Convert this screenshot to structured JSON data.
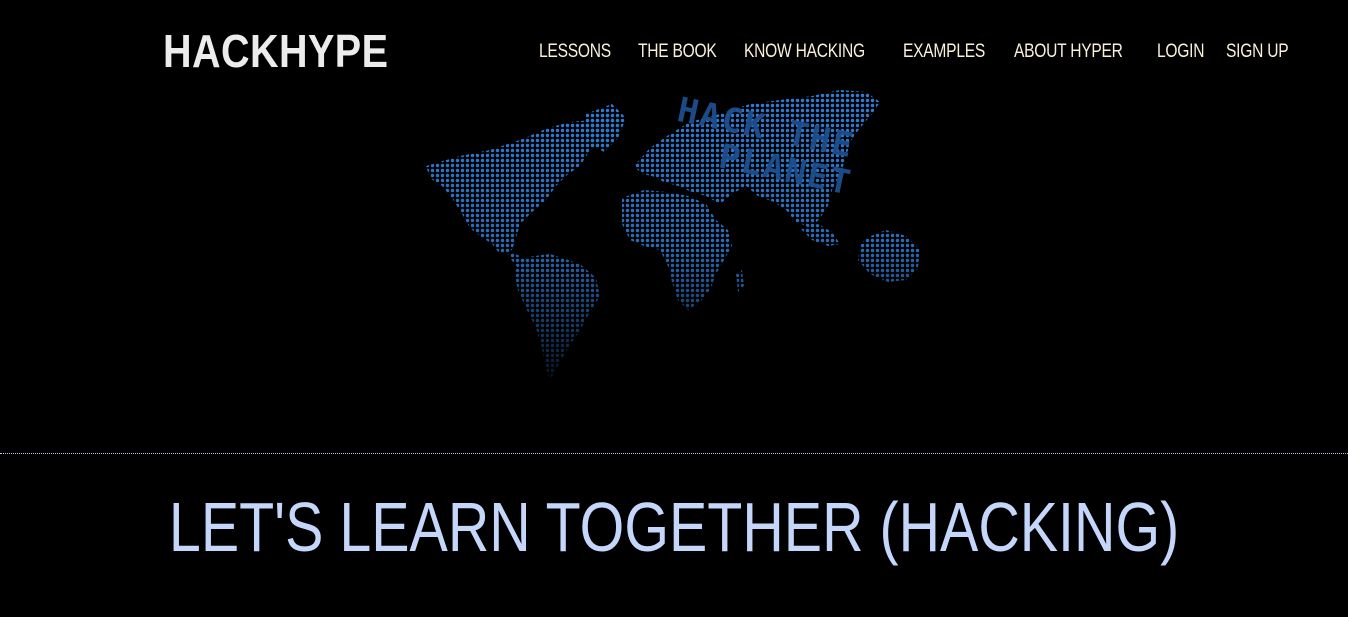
{
  "header": {
    "brand": "HACKHYPE",
    "nav": [
      {
        "label": "LESSONS"
      },
      {
        "label": "THE BOOK"
      },
      {
        "label": "KNOW HACKING"
      },
      {
        "label": "EXAMPLES"
      },
      {
        "label": "ABOUT HYPER"
      },
      {
        "label": "LOGIN"
      },
      {
        "label": "SIGN UP"
      }
    ]
  },
  "hero": {
    "map_text_line1": "HACK THE",
    "map_text_line2": "PLANET",
    "map_color": "#2f7fd8"
  },
  "main": {
    "headline": "LET'S LEARN TOGETHER (HACKING)"
  },
  "colors": {
    "background": "#000000",
    "brand": "#ececec",
    "nav": "#fbf1da",
    "headline": "#c4d6fa"
  }
}
